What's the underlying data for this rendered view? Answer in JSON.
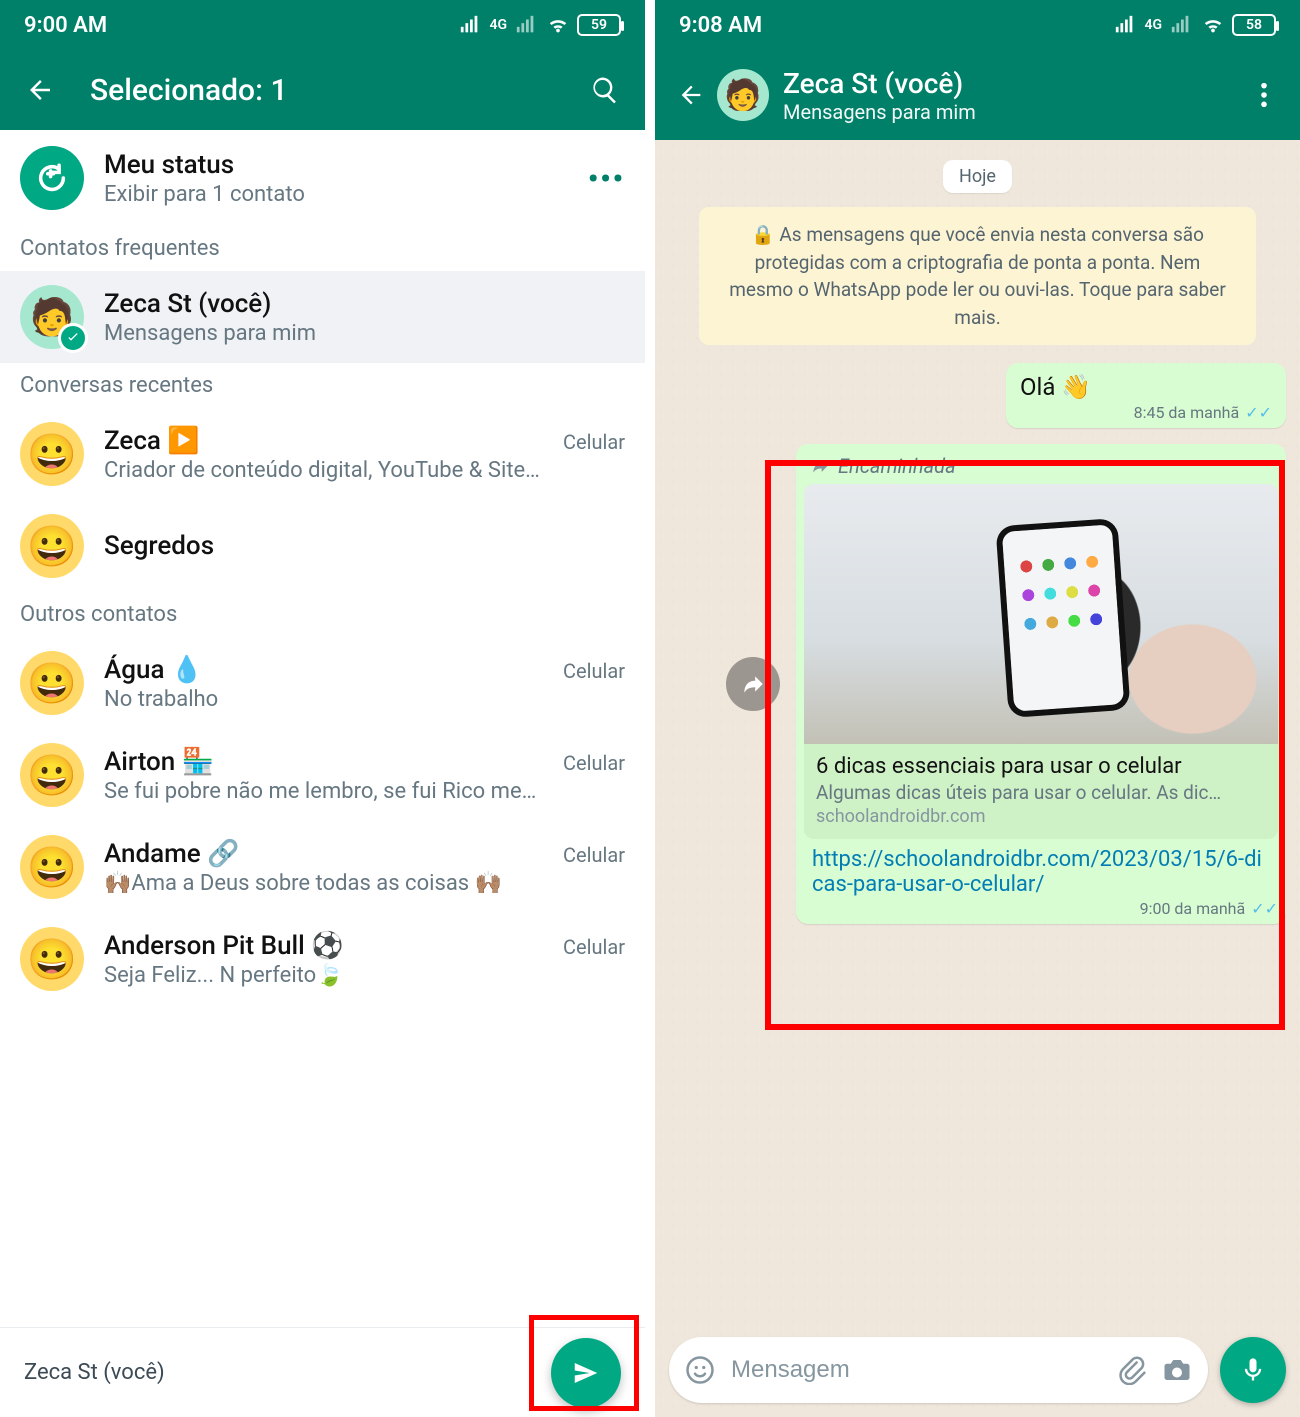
{
  "left": {
    "status_time": "9:00 AM",
    "battery": "59",
    "header": "Selecionado: 1",
    "my_status": {
      "title": "Meu status",
      "sub": "Exibir para 1 contato"
    },
    "section_frequent": "Contatos frequentes",
    "contact_self": {
      "name": "Zeca St (você)",
      "sub": "Mensagens para mim"
    },
    "section_recent": "Conversas recentes",
    "recents": [
      {
        "name": "Zeca ▶️",
        "sub": "Criador de conteúdo digital, YouTube & Site…",
        "tag": "Celular"
      },
      {
        "name": "Segredos",
        "sub": "",
        "tag": ""
      }
    ],
    "section_others": "Outros contatos",
    "others": [
      {
        "name": "Água 💧",
        "sub": "No trabalho",
        "tag": "Celular"
      },
      {
        "name": "Airton 🏪",
        "sub": "Se fui pobre não me lembro, se fui Rico me…",
        "tag": "Celular"
      },
      {
        "name": "Andame 🔗",
        "sub": "🙌🏽Ama a Deus sobre todas as coisas 🙌🏽",
        "tag": "Celular"
      },
      {
        "name": "Anderson Pit Bull ⚽",
        "sub": "Seja Feliz... N perfeito🍃",
        "tag": "Celular"
      }
    ],
    "bottom_names": "Zeca St (você)"
  },
  "right": {
    "status_time": "9:08 AM",
    "battery": "58",
    "chat_name": "Zeca St (você)",
    "chat_sub": "Mensagens para mim",
    "date": "Hoje",
    "enc_notice": "🔒 As mensagens que você envia nesta conversa são protegidas com a criptografia de ponta a ponta. Nem mesmo o WhatsApp pode ler ou ouvi-las. Toque para saber mais.",
    "m1": {
      "text": "Olá 👋",
      "time": "8:45 da manhã"
    },
    "m2": {
      "forwarded": "Encaminhada",
      "title": "6 dicas essenciais para usar o celular",
      "desc": "Algumas dicas úteis para usar o celular. As dic…",
      "domain": "schoolandroidbr.com",
      "url": "https://schoolandroidbr.com/2023/03/15/6-dicas-para-usar-o-celular/",
      "time": "9:00 da manhã"
    },
    "input_placeholder": "Mensagem"
  }
}
